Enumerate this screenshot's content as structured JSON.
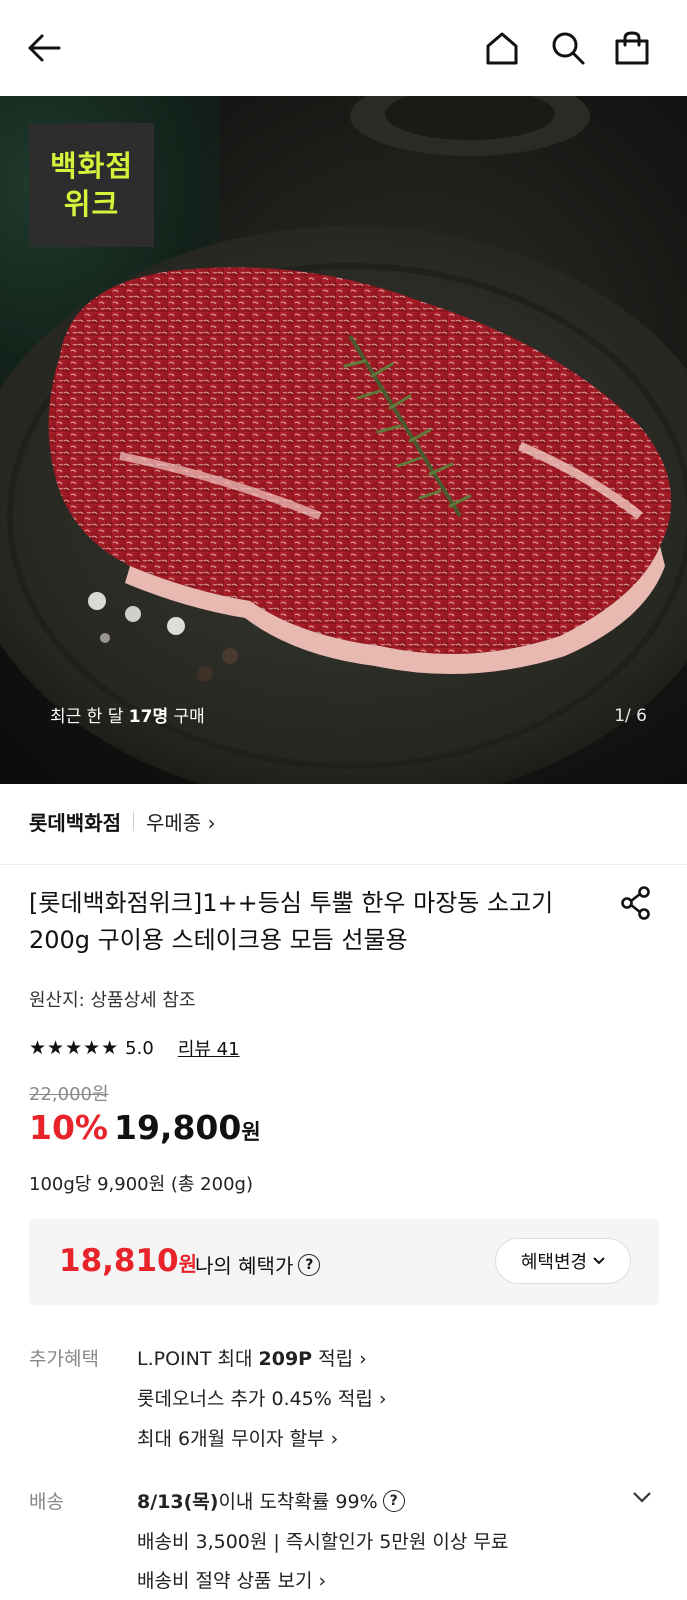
{
  "header": {
    "back_icon": "back-arrow-icon",
    "home_icon": "home-icon",
    "search_icon": "search-icon",
    "bag_icon": "shopping-bag-icon"
  },
  "hero": {
    "badge_line1": "백화점",
    "badge_line2": "위크",
    "caption_pre": "최근 한 달 ",
    "caption_bold": "17명",
    "caption_post": " 구매",
    "counter": "1/ 6"
  },
  "brand": {
    "name": "롯데백화점",
    "seller": "우메종",
    "seller_chevron": "›"
  },
  "product": {
    "title": "[롯데백화점위크]1++등심 투뿔 한우 마장동 소고기 200g 구이용 스테이크용 모듬 선물용",
    "origin": "원산지: 상품상세 참조",
    "stars": "★★★★★",
    "score": "5.0",
    "review": "리뷰 41",
    "original_price": "22,000원",
    "discount": "10%",
    "price": "19,800",
    "currency": "원",
    "unit_price": "100g당 9,900원 (총 200g)"
  },
  "benefit": {
    "price": "18,810",
    "currency": "원",
    "label": "나의 혜택가",
    "help": "?",
    "button": "혜택변경",
    "button_chevron": "⌄"
  },
  "extra": {
    "label": "추가혜택",
    "line1_pre": "L.POINT 최대 ",
    "line1_bold": "209P",
    "line1_post": " 적립 ›",
    "line2": "롯데오너스 추가 0.45% 적립 ›",
    "line3": "최대 6개월 무이자 할부 ›"
  },
  "shipping": {
    "label": "배송",
    "line1_bold": "8/13(목)",
    "line1_post": " 이내 도착확률 99%",
    "help": "?",
    "line2": "배송비 3,500원 | 즉시할인가 5만원 이상 무료",
    "line3": "배송비 절약 상품 보기 ›"
  },
  "colors": {
    "accent_red": "#e8232a",
    "badge_text": "#d7f23a",
    "badge_bg": "#2d2d2d"
  }
}
